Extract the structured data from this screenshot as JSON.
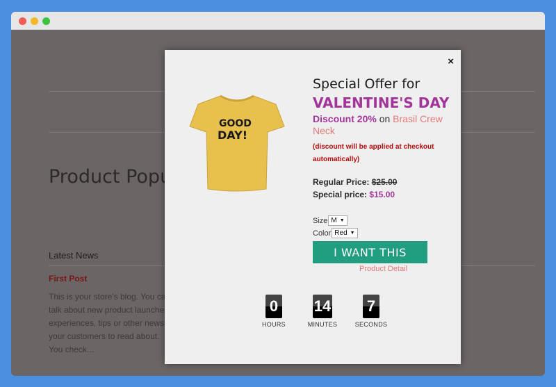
{
  "background_page": {
    "title": "Product Popup",
    "latest_news_heading": "Latest News",
    "post_title": "First Post",
    "post_excerpt": "This is your store's blog. You can talk about new product launches, experiences, tips or other news your customers to read about. You check..."
  },
  "popup": {
    "close_label": "×",
    "offer_line": "Special Offer for",
    "holiday": "VALENTINE'S DAY",
    "discount_pct": "Discount 20%",
    "discount_on": "on",
    "product_name": "Brasil Crew Neck",
    "note": "(discount will be applied at checkout automatically)",
    "regular_label": "Regular Price:",
    "regular_price": "$25.00",
    "special_label": "Special price:",
    "special_price": "$15.00",
    "size_label": "Size",
    "size_value": "M",
    "color_label": "Color",
    "color_value": "Red",
    "cta_label": "I WANT THIS",
    "detail_link": "Product Detail",
    "shirt_print": [
      "GOOD",
      "DAY!"
    ]
  },
  "countdown": [
    {
      "value": "0",
      "label": "HOURS"
    },
    {
      "value": "14",
      "label": "MINUTES"
    },
    {
      "value": "7",
      "label": "SECONDS"
    }
  ],
  "colors": {
    "accent_purple": "#a3359a",
    "cta_green": "#219d80",
    "link_salmon": "#e07a78",
    "note_red": "#b30c0c"
  }
}
